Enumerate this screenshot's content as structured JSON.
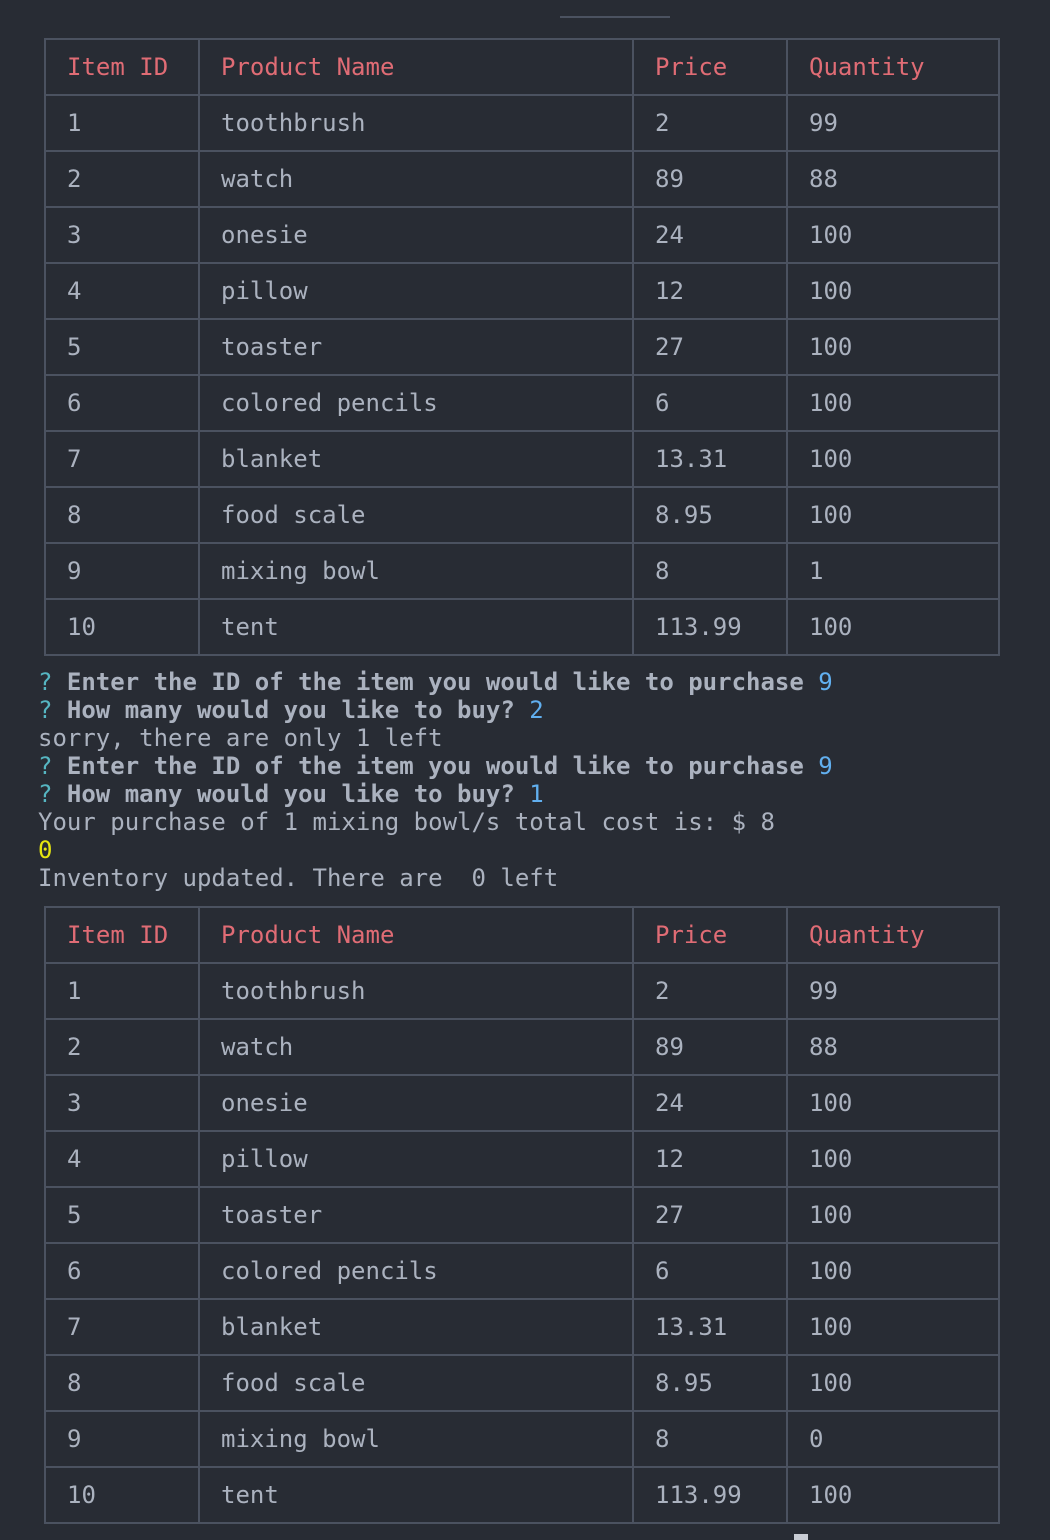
{
  "tables": {
    "headers": [
      "Item ID",
      "Product Name",
      "Price",
      "Quantity"
    ],
    "before": [
      [
        "1",
        "toothbrush",
        "2",
        "99"
      ],
      [
        "2",
        "watch",
        "89",
        "88"
      ],
      [
        "3",
        "onesie",
        "24",
        "100"
      ],
      [
        "4",
        "pillow",
        "12",
        "100"
      ],
      [
        "5",
        "toaster",
        "27",
        "100"
      ],
      [
        "6",
        "colored pencils",
        "6",
        "100"
      ],
      [
        "7",
        "blanket",
        "13.31",
        "100"
      ],
      [
        "8",
        "food scale",
        "8.95",
        "100"
      ],
      [
        "9",
        "mixing bowl",
        "8",
        "1"
      ],
      [
        "10",
        "tent",
        "113.99",
        "100"
      ]
    ],
    "after": [
      [
        "1",
        "toothbrush",
        "2",
        "99"
      ],
      [
        "2",
        "watch",
        "89",
        "88"
      ],
      [
        "3",
        "onesie",
        "24",
        "100"
      ],
      [
        "4",
        "pillow",
        "12",
        "100"
      ],
      [
        "5",
        "toaster",
        "27",
        "100"
      ],
      [
        "6",
        "colored pencils",
        "6",
        "100"
      ],
      [
        "7",
        "blanket",
        "13.31",
        "100"
      ],
      [
        "8",
        "food scale",
        "8.95",
        "100"
      ],
      [
        "9",
        "mixing bowl",
        "8",
        "0"
      ],
      [
        "10",
        "tent",
        "113.99",
        "100"
      ]
    ]
  },
  "console": {
    "prompt_mark": "?",
    "prompt_id": "Enter the ID of the item you would like to purchase",
    "prompt_qty": "How many would you like to buy?",
    "answer_id_1": "9",
    "answer_qty_1": "2",
    "sorry": "sorry, there are only 1 left",
    "answer_id_2": "9",
    "answer_qty_2": "1",
    "purchase": "Your purchase of 1 mixing bowl/s total cost is: $ 8",
    "zero": "0",
    "inventory": "Inventory updated. There are  0 left"
  },
  "colors": {
    "background": "#282c34",
    "header_text": "#e06c75",
    "prompt_mark": "#56b6c2",
    "answer": "#61afef",
    "zero_value": "#e5e510"
  }
}
